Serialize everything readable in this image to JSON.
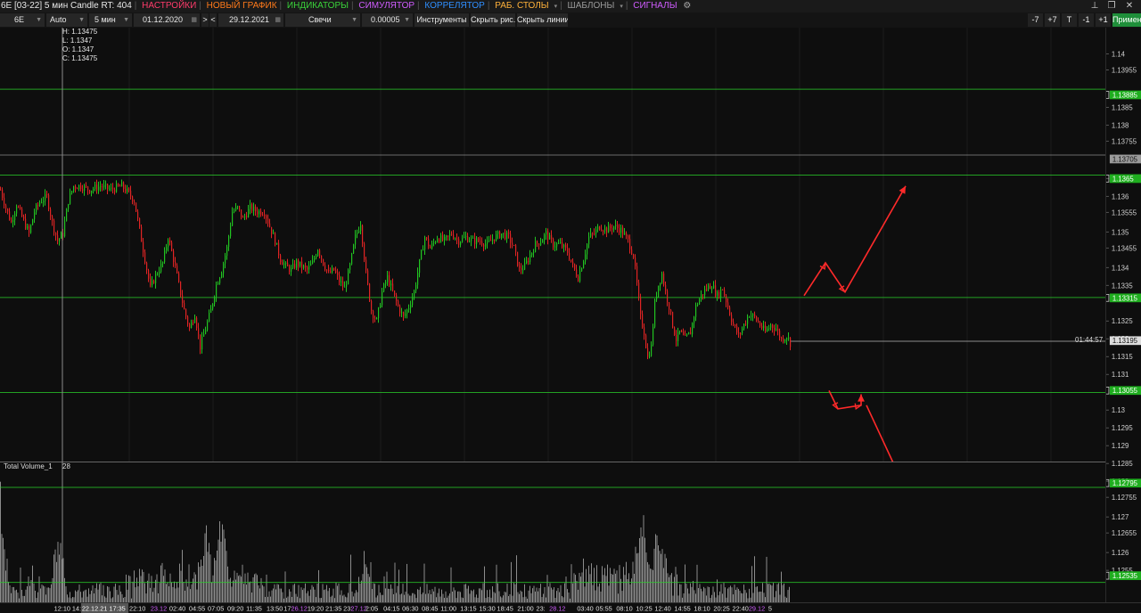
{
  "menu": {
    "title": "6E [03-22] 5 мин Candle RT: 404",
    "items": [
      {
        "label": "НАСТРОЙКИ",
        "color": "#ff3b6b"
      },
      {
        "label": "НОВЫЙ ГРАФИК",
        "color": "#ff7a1a"
      },
      {
        "label": "ИНДИКАТОРЫ",
        "color": "#3ad33a"
      },
      {
        "label": "СИМУЛЯТОР",
        "color": "#d05cff"
      },
      {
        "label": "КОРРЕЛЯТОР",
        "color": "#2f8fff"
      },
      {
        "label": "РАБ. СТОЛЫ",
        "color": "#ffb13a"
      },
      {
        "label": "ШАБЛОНЫ",
        "color": "#9a9a9a"
      },
      {
        "label": "СИГНАЛЫ",
        "color": "#d05cff"
      }
    ]
  },
  "toolbar": {
    "symbol": "6E",
    "scale": "Auto",
    "timeframe": "5 мин",
    "date_from": "01.12.2020",
    "nav_forward": ">",
    "nav_back": "<",
    "date_to": "29.12.2021",
    "chart_type": "Свечи",
    "tick_size": "0.00005",
    "instruments": "Инструменты",
    "hide_drawings": "Скрыть рис.",
    "hide_lines": "Скрыть линии",
    "step_buttons": [
      "-7",
      "+7",
      "T",
      "-1",
      "+1"
    ],
    "apply": "Примен"
  },
  "ohlc": {
    "h": "H: 1.13475",
    "l": "L: 1.1347",
    "o": "O: 1.1347",
    "c": "C: 1.13475"
  },
  "indicator": {
    "title": "Total Volume_1",
    "value": "28"
  },
  "timer": "01:44:57",
  "y_axis": {
    "ticks": [
      "1.14",
      "1.13955",
      "1.1385",
      "1.138",
      "1.13755",
      "1.1365",
      "1.136",
      "1.13555",
      "1.135",
      "1.13455",
      "1.134",
      "1.1335",
      "1.1325",
      "1.132",
      "1.1315",
      "1.131",
      "1.13",
      "1.1295",
      "1.129",
      "1.1285",
      "1.128",
      "1.12755",
      "1.127",
      "1.12655",
      "1.126",
      "1.1255"
    ],
    "levels": [
      {
        "value": "1.13885",
        "color": "#2bd12b"
      },
      {
        "value": "1.13705",
        "color": "#8a8a8a"
      },
      {
        "value": "1.1365",
        "color": "#2bd12b"
      },
      {
        "value": "1.13315",
        "color": "#2bd12b"
      },
      {
        "value": "1.13195",
        "color": "#9a9a9a"
      },
      {
        "value": "1.13055",
        "color": "#2bd12b"
      },
      {
        "value": "1.12795",
        "color": "#2bd12b"
      },
      {
        "value": "1.12535",
        "color": "#2bd12b"
      }
    ]
  },
  "x_axis": {
    "labels": [
      {
        "t": "12:10",
        "c": "#e0e0e0"
      },
      {
        "t": "14:",
        "c": "#e0e0e0"
      },
      {
        "t": "22.12.21 17:35",
        "c": "#ffffff",
        "hl": true
      },
      {
        "t": "22:10",
        "c": "#e0e0e0"
      },
      {
        "t": "23.12",
        "c": "#d05cff"
      },
      {
        "t": "02:40",
        "c": "#e0e0e0"
      },
      {
        "t": "04:55",
        "c": "#e0e0e0"
      },
      {
        "t": "07:05",
        "c": "#e0e0e0"
      },
      {
        "t": "09:20",
        "c": "#e0e0e0"
      },
      {
        "t": "11:35",
        "c": "#e0e0e0"
      },
      {
        "t": "13:50",
        "c": "#e0e0e0"
      },
      {
        "t": "17:",
        "c": "#e0e0e0"
      },
      {
        "t": "26.12",
        "c": "#d05cff"
      },
      {
        "t": "19:20",
        "c": "#e0e0e0"
      },
      {
        "t": "21:35",
        "c": "#e0e0e0"
      },
      {
        "t": "23:",
        "c": "#e0e0e0"
      },
      {
        "t": "27.12",
        "c": "#d05cff"
      },
      {
        "t": "2:05",
        "c": "#e0e0e0"
      },
      {
        "t": "04:15",
        "c": "#e0e0e0"
      },
      {
        "t": "06:30",
        "c": "#e0e0e0"
      },
      {
        "t": "08:45",
        "c": "#e0e0e0"
      },
      {
        "t": "11:00",
        "c": "#e0e0e0"
      },
      {
        "t": "13:15",
        "c": "#e0e0e0"
      },
      {
        "t": "15:30",
        "c": "#e0e0e0"
      },
      {
        "t": "18:45",
        "c": "#e0e0e0"
      },
      {
        "t": "21:00",
        "c": "#e0e0e0"
      },
      {
        "t": "23:",
        "c": "#e0e0e0"
      },
      {
        "t": "28.12",
        "c": "#d05cff"
      },
      {
        "t": "03:40",
        "c": "#e0e0e0"
      },
      {
        "t": "05:55",
        "c": "#e0e0e0"
      },
      {
        "t": "08:10",
        "c": "#e0e0e0"
      },
      {
        "t": "10:25",
        "c": "#e0e0e0"
      },
      {
        "t": "12:40",
        "c": "#e0e0e0"
      },
      {
        "t": "14:55",
        "c": "#e0e0e0"
      },
      {
        "t": "18:10",
        "c": "#e0e0e0"
      },
      {
        "t": "20:25",
        "c": "#e0e0e0"
      },
      {
        "t": "22:40",
        "c": "#e0e0e0"
      },
      {
        "t": "29.12",
        "c": "#d05cff"
      },
      {
        "t": "5",
        "c": "#e0e0e0"
      }
    ]
  },
  "chart_data": {
    "type": "candlestick",
    "symbol": "6E [03-22]",
    "timeframe": "5 мин",
    "close_path": [
      [
        0,
        1.1361
      ],
      [
        6,
        1.1356
      ],
      [
        12,
        1.1352
      ],
      [
        18,
        1.1357
      ],
      [
        25,
        1.1353
      ],
      [
        32,
        1.1349
      ],
      [
        38,
        1.1355
      ],
      [
        45,
        1.1358
      ],
      [
        52,
        1.1359
      ],
      [
        58,
        1.1352
      ],
      [
        64,
        1.1347
      ],
      [
        70,
        1.1349
      ],
      [
        76,
        1.1358
      ],
      [
        82,
        1.1362
      ],
      [
        90,
        1.1362
      ],
      [
        100,
        1.1361
      ],
      [
        112,
        1.1362
      ],
      [
        124,
        1.1361
      ],
      [
        136,
        1.1362
      ],
      [
        144,
        1.136
      ],
      [
        150,
        1.1358
      ],
      [
        156,
        1.135
      ],
      [
        162,
        1.1342
      ],
      [
        168,
        1.1334
      ],
      [
        175,
        1.1338
      ],
      [
        182,
        1.1341
      ],
      [
        188,
        1.1348
      ],
      [
        194,
        1.1342
      ],
      [
        200,
        1.1335
      ],
      [
        206,
        1.1328
      ],
      [
        212,
        1.1323
      ],
      [
        218,
        1.1327
      ],
      [
        224,
        1.1318
      ],
      [
        230,
        1.1323
      ],
      [
        236,
        1.1328
      ],
      [
        242,
        1.1335
      ],
      [
        248,
        1.1339
      ],
      [
        254,
        1.1345
      ],
      [
        260,
        1.1355
      ],
      [
        266,
        1.1356
      ],
      [
        272,
        1.1353
      ],
      [
        280,
        1.1356
      ],
      [
        288,
        1.1355
      ],
      [
        296,
        1.1355
      ],
      [
        302,
        1.1351
      ],
      [
        308,
        1.1347
      ],
      [
        314,
        1.1342
      ],
      [
        320,
        1.134
      ],
      [
        326,
        1.1339
      ],
      [
        332,
        1.1341
      ],
      [
        338,
        1.134
      ],
      [
        344,
        1.1339
      ],
      [
        350,
        1.1341
      ],
      [
        356,
        1.1345
      ],
      [
        362,
        1.1341
      ],
      [
        368,
        1.1338
      ],
      [
        374,
        1.1339
      ],
      [
        380,
        1.1336
      ],
      [
        386,
        1.1334
      ],
      [
        392,
        1.134
      ],
      [
        398,
        1.1348
      ],
      [
        404,
        1.1352
      ],
      [
        410,
        1.1338
      ],
      [
        416,
        1.1328
      ],
      [
        422,
        1.1325
      ],
      [
        428,
        1.1333
      ],
      [
        434,
        1.1337
      ],
      [
        440,
        1.1333
      ],
      [
        446,
        1.1329
      ],
      [
        452,
        1.1326
      ],
      [
        458,
        1.1329
      ],
      [
        464,
        1.1333
      ],
      [
        470,
        1.1341
      ],
      [
        476,
        1.1348
      ],
      [
        482,
        1.1345
      ],
      [
        490,
        1.1348
      ],
      [
        498,
        1.1347
      ],
      [
        506,
        1.1349
      ],
      [
        514,
        1.1347
      ],
      [
        522,
        1.1348
      ],
      [
        530,
        1.1347
      ],
      [
        538,
        1.1347
      ],
      [
        546,
        1.1346
      ],
      [
        554,
        1.1348
      ],
      [
        562,
        1.1349
      ],
      [
        570,
        1.1348
      ],
      [
        576,
        1.1345
      ],
      [
        582,
        1.1339
      ],
      [
        588,
        1.134
      ],
      [
        594,
        1.1343
      ],
      [
        600,
        1.1346
      ],
      [
        606,
        1.1347
      ],
      [
        612,
        1.1349
      ],
      [
        620,
        1.1346
      ],
      [
        628,
        1.1346
      ],
      [
        636,
        1.1344
      ],
      [
        642,
        1.134
      ],
      [
        648,
        1.1337
      ],
      [
        654,
        1.1342
      ],
      [
        660,
        1.1348
      ],
      [
        666,
        1.1349
      ],
      [
        672,
        1.1351
      ],
      [
        680,
        1.135
      ],
      [
        688,
        1.1351
      ],
      [
        696,
        1.135
      ],
      [
        704,
        1.1347
      ],
      [
        710,
        1.1343
      ],
      [
        714,
        1.1335
      ],
      [
        718,
        1.1326
      ],
      [
        722,
        1.1322
      ],
      [
        726,
        1.1315
      ],
      [
        730,
        1.1318
      ],
      [
        734,
        1.133
      ],
      [
        738,
        1.1335
      ],
      [
        742,
        1.1338
      ],
      [
        746,
        1.1333
      ],
      [
        750,
        1.1329
      ],
      [
        754,
        1.1324
      ],
      [
        758,
        1.132
      ],
      [
        762,
        1.1322
      ],
      [
        768,
        1.132
      ],
      [
        774,
        1.1322
      ],
      [
        780,
        1.1329
      ],
      [
        786,
        1.1332
      ],
      [
        792,
        1.1334
      ],
      [
        798,
        1.1335
      ],
      [
        804,
        1.1332
      ],
      [
        810,
        1.1334
      ],
      [
        816,
        1.1329
      ],
      [
        822,
        1.1324
      ],
      [
        828,
        1.1321
      ],
      [
        834,
        1.1324
      ],
      [
        840,
        1.1327
      ],
      [
        846,
        1.1326
      ],
      [
        852,
        1.1324
      ],
      [
        858,
        1.1322
      ],
      [
        864,
        1.1324
      ],
      [
        870,
        1.1323
      ],
      [
        876,
        1.132
      ],
      [
        882,
        1.1321
      ],
      [
        886,
        1.1319
      ]
    ],
    "volume_spikes": [
      [
        0,
        140
      ],
      [
        65,
        95
      ],
      [
        230,
        78
      ],
      [
        248,
        90
      ],
      [
        408,
        60
      ],
      [
        720,
        100
      ],
      [
        735,
        70
      ],
      [
        742,
        55
      ]
    ],
    "annotations": [
      {
        "type": "arrow-path",
        "color": "#ff2a2a",
        "points": [
          [
            1.1332,
            902
          ],
          [
            1.1341,
            926
          ],
          [
            1.1333,
            948
          ],
          [
            1.1362,
            1016
          ]
        ]
      },
      {
        "type": "arrow-path",
        "color": "#ff2a2a",
        "points": [
          [
            1.1306,
            930
          ],
          [
            1.1301,
            940
          ],
          [
            1.1302,
            966
          ],
          [
            1.1305,
            966
          ]
        ]
      },
      {
        "type": "arrow-path",
        "color": "#ff2a2a",
        "points": [
          [
            1.1302,
            972
          ],
          [
            1.1281,
            1012
          ]
        ]
      }
    ]
  }
}
